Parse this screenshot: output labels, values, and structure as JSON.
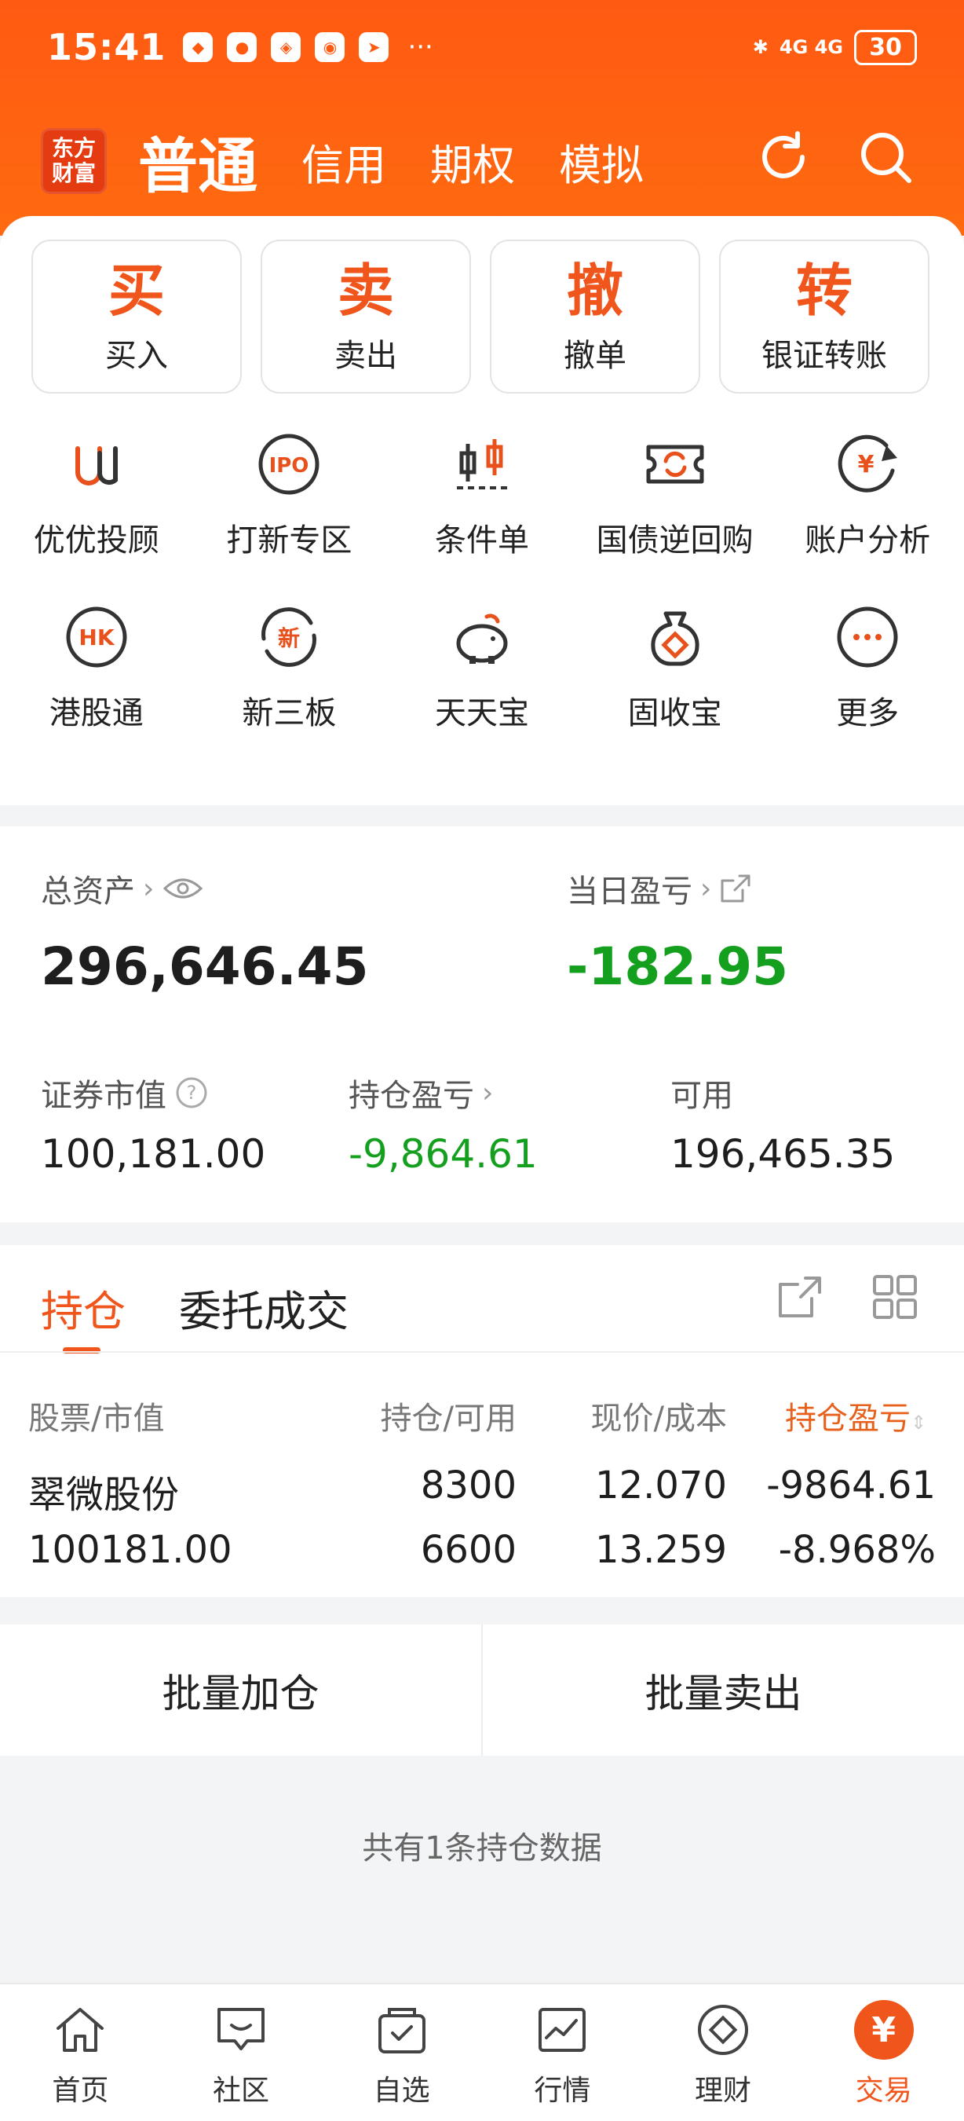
{
  "status_bar": {
    "time": "15:41",
    "signal": "4G 4G",
    "battery": "30",
    "notification_icons": [
      "shop-icon",
      "message-icon",
      "shield-icon",
      "wechat-icon",
      "send-icon"
    ]
  },
  "header": {
    "logo_line1": "东方",
    "logo_line2": "财富",
    "tabs": [
      {
        "label": "普通",
        "active": true
      },
      {
        "label": "信用"
      },
      {
        "label": "期权"
      },
      {
        "label": "模拟"
      }
    ]
  },
  "trade_buttons": [
    {
      "glyph": "买",
      "label": "买入"
    },
    {
      "glyph": "卖",
      "label": "卖出"
    },
    {
      "glyph": "撤",
      "label": "撤单"
    },
    {
      "glyph": "转",
      "label": "银证转账"
    }
  ],
  "features": [
    {
      "icon": "youyou-icon",
      "label": "优优投顾"
    },
    {
      "icon": "ipo-icon",
      "label": "打新专区"
    },
    {
      "icon": "condition-order-icon",
      "label": "条件单"
    },
    {
      "icon": "reverse-repo-icon",
      "label": "国债逆回购"
    },
    {
      "icon": "account-analysis-icon",
      "label": "账户分析"
    },
    {
      "icon": "hk-connect-icon",
      "label": "港股通"
    },
    {
      "icon": "new-third-board-icon",
      "label": "新三板"
    },
    {
      "icon": "piggy-bank-icon",
      "label": "天天宝"
    },
    {
      "icon": "money-bag-icon",
      "label": "固收宝"
    },
    {
      "icon": "more-icon",
      "label": "更多"
    }
  ],
  "assets": {
    "total_label": "总资产",
    "total_value": "296,646.45",
    "day_pl_label": "当日盈亏",
    "day_pl_value": "-182.95",
    "market_value_label": "证券市值",
    "market_value": "100,181.00",
    "hold_pl_label": "持仓盈亏",
    "hold_pl_value": "-9,864.61",
    "available_label": "可用",
    "available_value": "196,465.35"
  },
  "positions": {
    "tab_hold": "持仓",
    "tab_orders": "委托成交",
    "headers": {
      "stock": "股票/市值",
      "qty": "持仓/可用",
      "price": "现价/成本",
      "pl": "持仓盈亏"
    },
    "rows": [
      {
        "name": "翠微股份",
        "market_value": "100181.00",
        "holding": "8300",
        "available": "6600",
        "price": "12.070",
        "cost": "13.259",
        "pl": "-9864.61",
        "pl_pct": "-8.968%"
      }
    ]
  },
  "actions": {
    "batch_add": "批量加仓",
    "batch_sell": "批量卖出"
  },
  "footer_note": "共有1条持仓数据",
  "bottom_nav": [
    {
      "icon": "home-icon",
      "label": "首页"
    },
    {
      "icon": "community-icon",
      "label": "社区"
    },
    {
      "icon": "watchlist-icon",
      "label": "自选"
    },
    {
      "icon": "market-icon",
      "label": "行情"
    },
    {
      "icon": "wealth-icon",
      "label": "理财"
    },
    {
      "icon": "trade-icon",
      "label": "交易",
      "active": true
    }
  ],
  "colors": {
    "brand": "#ff5a12",
    "accent": "#f0551c",
    "loss_green": "#14a01e"
  }
}
